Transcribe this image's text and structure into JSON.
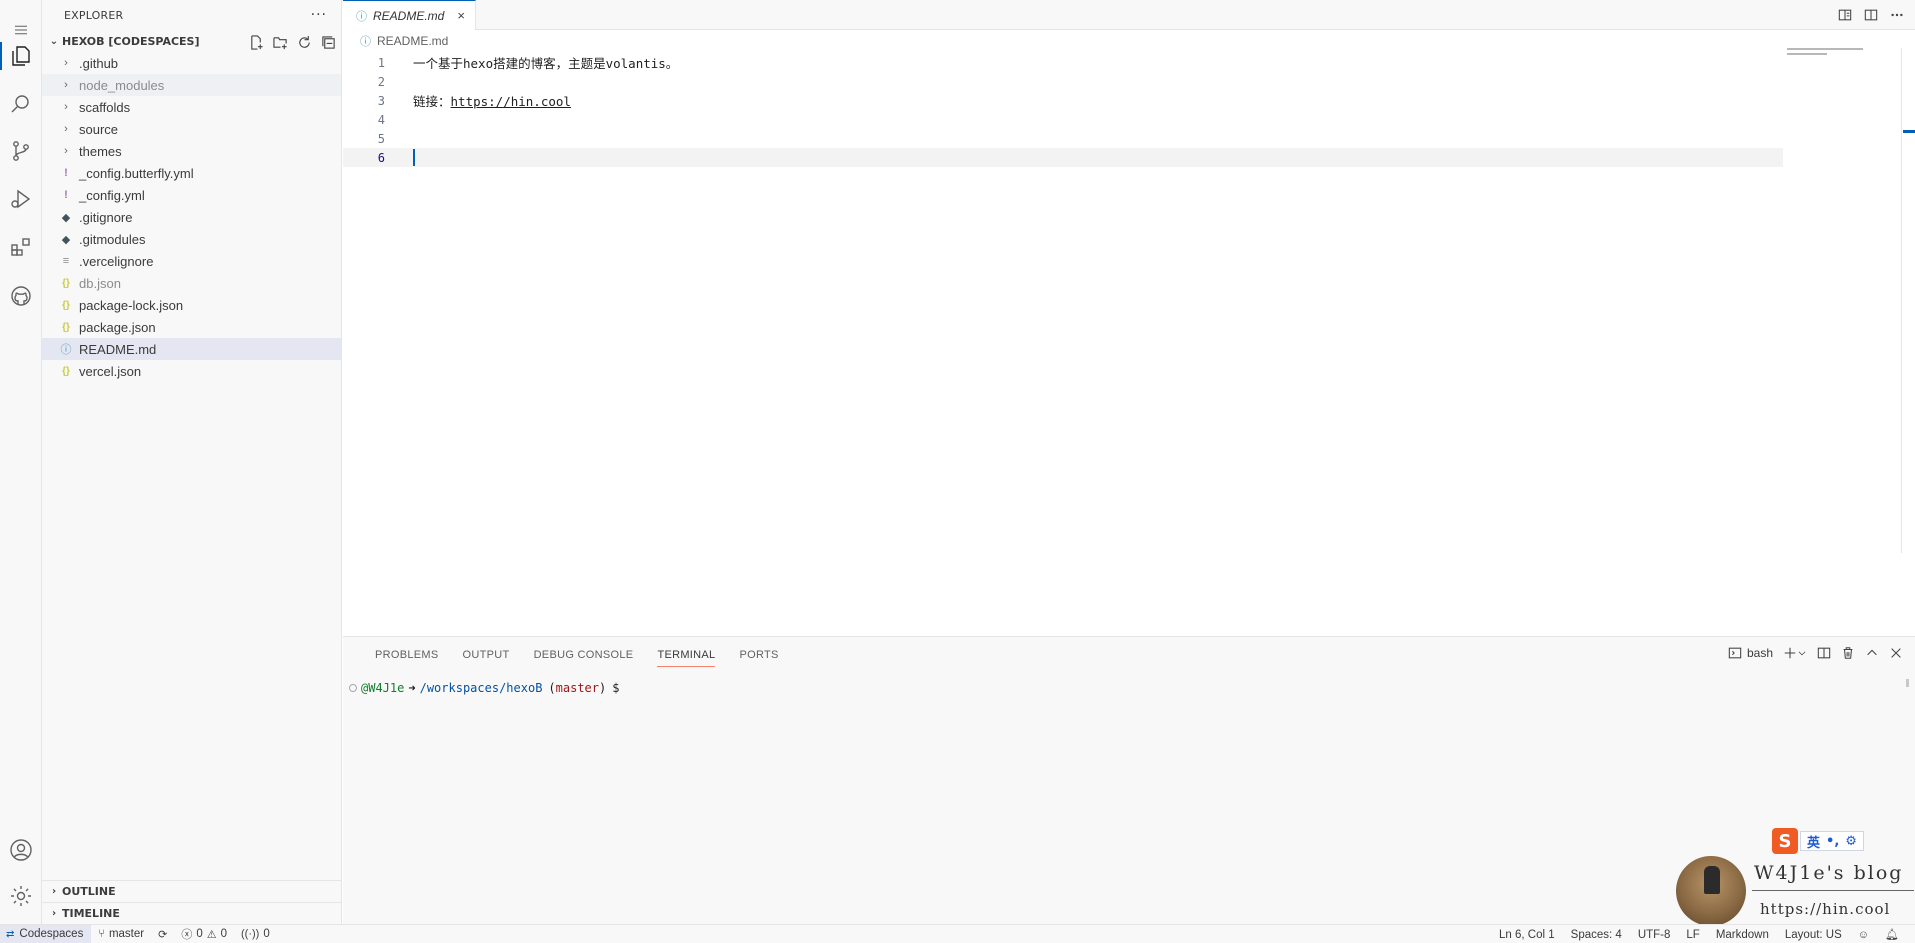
{
  "explorer": {
    "title": "EXPLORER",
    "more_label": "···",
    "root": "HEXOB [CODESPACES]",
    "items": [
      {
        "name": ".github",
        "icon": "chevron-right-icon",
        "kind": "folder"
      },
      {
        "name": "node_modules",
        "icon": "chevron-right-icon",
        "kind": "folder",
        "dim": true
      },
      {
        "name": "scaffolds",
        "icon": "chevron-right-icon",
        "kind": "folder"
      },
      {
        "name": "source",
        "icon": "chevron-right-icon",
        "kind": "folder"
      },
      {
        "name": "themes",
        "icon": "chevron-right-icon",
        "kind": "folder"
      },
      {
        "name": "_config.butterfly.yml",
        "icon": "yaml-icon",
        "kind": "yml"
      },
      {
        "name": "_config.yml",
        "icon": "yaml-icon",
        "kind": "yml"
      },
      {
        "name": ".gitignore",
        "icon": "git-icon",
        "kind": "git"
      },
      {
        "name": ".gitmodules",
        "icon": "git-icon",
        "kind": "git"
      },
      {
        "name": ".vercelignore",
        "icon": "lines-icon",
        "kind": "ignore"
      },
      {
        "name": "db.json",
        "icon": "json-icon",
        "kind": "json",
        "dim": true
      },
      {
        "name": "package-lock.json",
        "icon": "json-icon",
        "kind": "json"
      },
      {
        "name": "package.json",
        "icon": "json-icon",
        "kind": "json"
      },
      {
        "name": "README.md",
        "icon": "info-icon",
        "kind": "info",
        "selected": true
      },
      {
        "name": "vercel.json",
        "icon": "json-icon",
        "kind": "json"
      }
    ],
    "glyphs": {
      "chevron": "›",
      "yml": "!",
      "git": "◆",
      "ignore": "≡",
      "json": "{}",
      "info": "ⓘ"
    },
    "outline": "OUTLINE",
    "timeline": "TIMELINE"
  },
  "editor": {
    "tab_label": "README.md",
    "tab_close": "×",
    "tab_icon_glyph": "ⓘ",
    "breadcrumb": "README.md",
    "lines": [
      {
        "num": "1",
        "text": "一个基于hexo搭建的博客，主题是volantis。"
      },
      {
        "num": "2",
        "text": ""
      },
      {
        "num": "3",
        "prefix": "链接：",
        "link": "https://hin.cool"
      },
      {
        "num": "4",
        "text": ""
      },
      {
        "num": "5",
        "text": ""
      },
      {
        "num": "6",
        "text": "",
        "current": true
      }
    ]
  },
  "panel": {
    "tabs": [
      "PROBLEMS",
      "OUTPUT",
      "DEBUG CONSOLE",
      "TERMINAL",
      "PORTS"
    ],
    "active_tab": "TERMINAL",
    "shell": "bash",
    "prompt": {
      "user": "@W4J1e",
      "arrow": "➜",
      "path": "/workspaces/hexoB",
      "branch_open": "(",
      "branch": "master",
      "branch_close": ")",
      "symbol": "$"
    }
  },
  "watermark": {
    "ime_logo": "S",
    "ime_chars": [
      "英",
      "•,",
      "⚙"
    ],
    "blog_name": "W4J1e's blog",
    "blog_url": "https://hin.cool"
  },
  "statusbar": {
    "remote": "Codespaces",
    "branch": "master",
    "errors": "0",
    "warnings": "0",
    "ports": "0",
    "position": "Ln 6, Col 1",
    "spaces": "Spaces: 4",
    "encoding": "UTF-8",
    "eol": "LF",
    "language": "Markdown",
    "layout": "Layout: US"
  },
  "colors": {
    "accent": "#005fb8",
    "terminal_underline": "#f9826c",
    "json_icon": "#cbcb41",
    "yml_icon": "#a074c4",
    "info_icon": "#519aba"
  }
}
